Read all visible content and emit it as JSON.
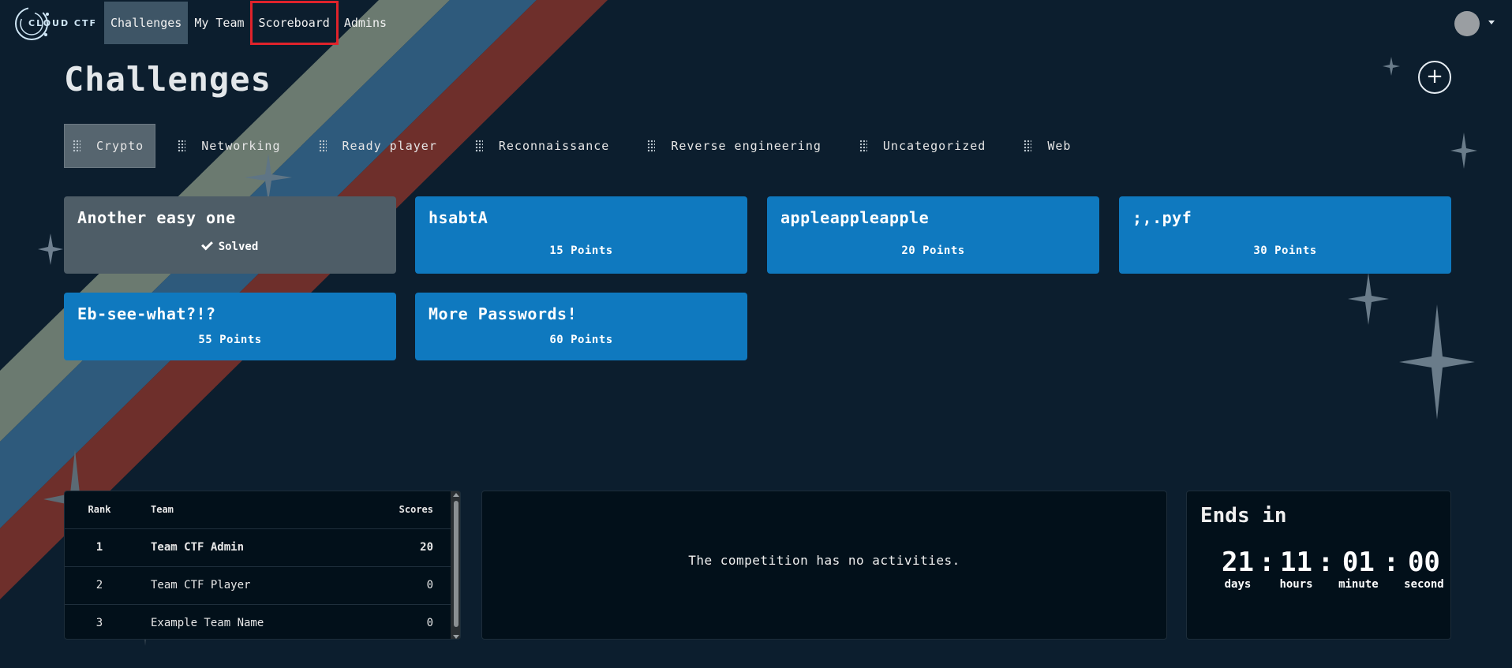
{
  "nav": {
    "brand": "CLOUD CTF",
    "links": [
      {
        "label": "Challenges"
      },
      {
        "label": "My Team"
      },
      {
        "label": "Scoreboard"
      },
      {
        "label": "Admins"
      }
    ]
  },
  "page": {
    "title": "Challenges",
    "add_label": "+"
  },
  "categories": [
    {
      "label": "Crypto"
    },
    {
      "label": "Networking"
    },
    {
      "label": "Ready player"
    },
    {
      "label": "Reconnaissance"
    },
    {
      "label": "Reverse engineering"
    },
    {
      "label": "Uncategorized"
    },
    {
      "label": "Web"
    }
  ],
  "challenges": [
    {
      "title": "Another easy one",
      "status": "Solved"
    },
    {
      "title": "hsabtA",
      "points": "15 Points"
    },
    {
      "title": "appleappleapple",
      "points": "20 Points"
    },
    {
      "title": ";,.pyf",
      "points": "30 Points"
    },
    {
      "title": "Eb-see-what?!?",
      "points": "55 Points"
    },
    {
      "title": "More Passwords!",
      "points": "60 Points"
    }
  ],
  "scoreboard": {
    "headers": {
      "rank": "Rank",
      "team": "Team",
      "scores": "Scores"
    },
    "rows": [
      {
        "rank": "1",
        "team": "Team CTF Admin",
        "score": "20"
      },
      {
        "rank": "2",
        "team": "Team CTF Player",
        "score": "0"
      },
      {
        "rank": "3",
        "team": "Example Team Name",
        "score": "0"
      }
    ]
  },
  "activity": {
    "message": "The competition has no activities."
  },
  "countdown": {
    "title": "Ends in",
    "days": "21",
    "hours": "11",
    "minutes": "01",
    "seconds": "00",
    "labels": {
      "days": "days",
      "hours": "hours",
      "minutes": "minute",
      "seconds": "second"
    },
    "separator": ":"
  },
  "colors": {
    "background": "#0c1e2e",
    "card": "#0f79bf",
    "card_solved": "#4e5d67",
    "tab_active": "#56656f",
    "nav_active": "#3e5566",
    "highlight_box": "#e0232b",
    "stripe_gray": "#6b7a70",
    "stripe_blue": "#2e5a7c",
    "stripe_red": "#6e2f2b"
  }
}
